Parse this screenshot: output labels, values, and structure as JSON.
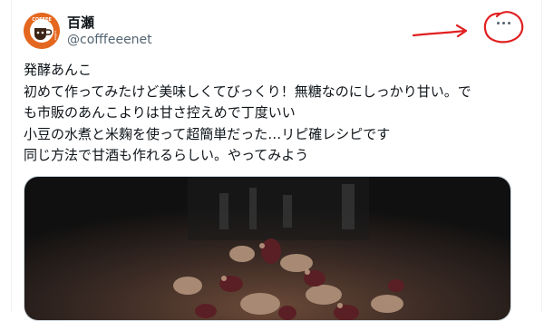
{
  "tweet": {
    "display_name": "百瀬",
    "handle": "@cofffeeenet",
    "avatar_text_top": "COFFEE",
    "avatar_text_right": "coffee",
    "lines": [
      "発酵あんこ",
      "初めて作ってみたけど美味しくてびっくり！無糖なのにしっかり甘い。で",
      "も市販のあんこよりは甘さ控えめで丁度いい",
      "小豆の水煮と米麹を使って超簡単だった…リピ確レシピです",
      "同じ方法で甘酒も作れるらしい。やってみよう"
    ],
    "more_icon": "more-horizontal-icon"
  },
  "colors": {
    "annotation": "#e02020",
    "avatar_bg": "#e4671f",
    "secondary_text": "#536471"
  }
}
